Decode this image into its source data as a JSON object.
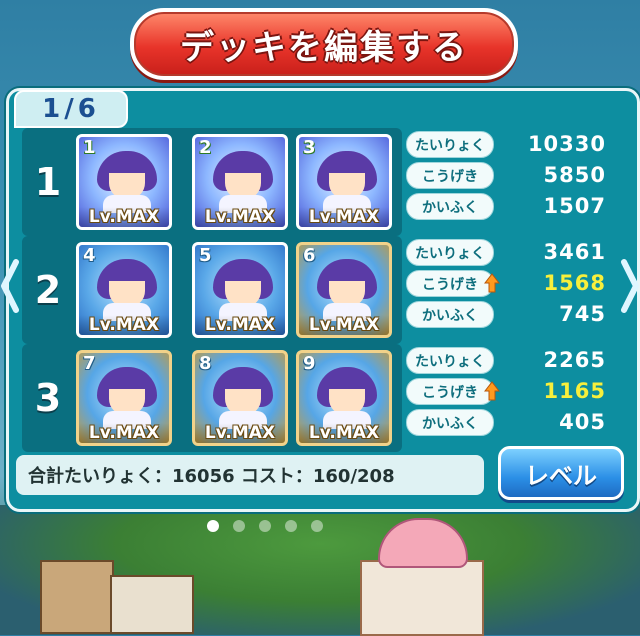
{
  "title": "デッキを編集する",
  "page_indicator": "1/6",
  "rows": [
    {
      "number": "1",
      "cards": [
        {
          "num": "1",
          "level": "Lv.MAX",
          "style": "rainbow"
        },
        {
          "num": "2",
          "level": "Lv.MAX",
          "style": "rainbow"
        },
        {
          "num": "3",
          "level": "Lv.MAX",
          "style": "rainbow"
        }
      ],
      "stats": [
        {
          "label": "たいりょく",
          "value": "10330",
          "boosted": false
        },
        {
          "label": "こうげき",
          "value": "5850",
          "boosted": false
        },
        {
          "label": "かいふく",
          "value": "1507",
          "boosted": false
        }
      ]
    },
    {
      "number": "2",
      "cards": [
        {
          "num": "4",
          "level": "Lv.MAX",
          "style": "blue"
        },
        {
          "num": "5",
          "level": "Lv.MAX",
          "style": "blue"
        },
        {
          "num": "6",
          "level": "Lv.MAX",
          "style": "gold"
        }
      ],
      "stats": [
        {
          "label": "たいりょく",
          "value": "3461",
          "boosted": false
        },
        {
          "label": "こうげき",
          "value": "1568",
          "boosted": true
        },
        {
          "label": "かいふく",
          "value": "745",
          "boosted": false
        }
      ]
    },
    {
      "number": "3",
      "cards": [
        {
          "num": "7",
          "level": "Lv.MAX",
          "style": "gold"
        },
        {
          "num": "8",
          "level": "Lv.MAX",
          "style": "gold"
        },
        {
          "num": "9",
          "level": "Lv.MAX",
          "style": "gold"
        }
      ],
      "stats": [
        {
          "label": "たいりょく",
          "value": "2265",
          "boosted": false
        },
        {
          "label": "こうげき",
          "value": "1165",
          "boosted": true
        },
        {
          "label": "かいふく",
          "value": "405",
          "boosted": false
        }
      ]
    }
  ],
  "summary": "合計たいりょく：16056 コスト：160/208",
  "level_button": "レベル",
  "page_dots": {
    "count": 5,
    "active_index": 0
  },
  "colors": {
    "accent_red": "#e8342a",
    "panel_teal": "#0d8ea0",
    "boost_yellow": "#f7ef3c",
    "level_blue": "#2b8fe6"
  },
  "icons": [
    "chevron-left-icon",
    "chevron-right-icon",
    "attack-up-arrow-icon"
  ]
}
